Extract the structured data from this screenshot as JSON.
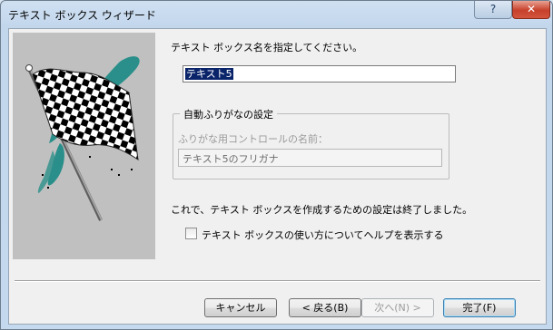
{
  "window": {
    "title": "テキスト ボックス ウィザード",
    "help_glyph": "?",
    "close_glyph": "✕"
  },
  "form": {
    "name_prompt": "テキスト ボックス名を指定してください。",
    "name_value": "テキスト5",
    "furigana_group_title": "自動ふりがなの設定",
    "furigana_control_label": "ふりがな用コントロールの名前：",
    "furigana_control_value": "テキスト5のフリガナ",
    "finish_message": "これで、テキスト ボックスを作成するための設定は終了しました。",
    "help_checkbox_label": "テキスト ボックスの使い方についてヘルプを表示する",
    "help_checkbox_checked": false
  },
  "buttons": {
    "cancel": "キャンセル",
    "back": "< 戻る(B)",
    "next": "次へ(N) >",
    "finish": "完了(F)"
  },
  "illustration": {
    "icon": "checkered-flag-icon",
    "colors": {
      "panel": "#c0c0c0",
      "teal": "#2a8f8a",
      "pole": "#7a7a7a"
    }
  }
}
